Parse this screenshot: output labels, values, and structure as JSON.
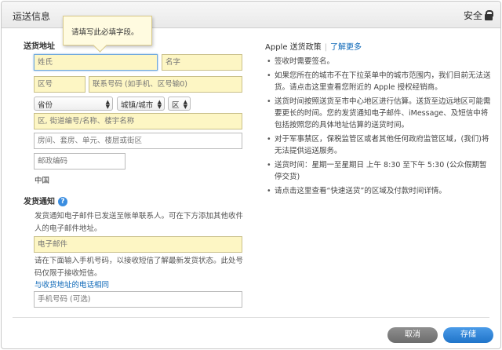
{
  "header": {
    "title": "运送信息",
    "secure_label": "安全"
  },
  "tooltip": {
    "text": "请填写此必填字段。"
  },
  "address": {
    "title": "送货地址",
    "surname_placeholder": "姓氏",
    "name_placeholder": "名字",
    "area_code_placeholder": "区号",
    "phone_placeholder": "联系号码 (如手机、区号输0)",
    "province_select": "省份",
    "city_select": "城镇/城市",
    "district_select": "区",
    "street_placeholder": "区, 街道编号/名称、楼宇名称",
    "unit_placeholder": "房间、套房、单元、楼层或街区",
    "postcode_placeholder": "邮政编码",
    "country": "中国"
  },
  "notification": {
    "title": "发货通知",
    "email_desc": "发货通知电子邮件已发送至帐单联系人。可在下方添加其他收件人的电子邮件地址。",
    "email_placeholder": "电子邮件",
    "sms_desc": "请在下面输入手机号码，以接收短信了解最新发货状态。此处号码仅限于接收短信。",
    "same_phone_link": "与收货地址的电话相同",
    "mobile_placeholder": "手机号码 (可选)"
  },
  "policy": {
    "title": "Apple 送货政策",
    "learn_more": "了解更多",
    "items": [
      "签收时需要签名。",
      "如果您所在的城市不在下拉菜单中的城市范围内，我们目前无法送货。请点击这里查看您附近的 Apple 授权经销商。",
      "送货时间按照送货至市中心地区进行估算。送货至边远地区可能需要更长的时间。您的发货通知电子邮件、iMessage、及短信中将包括按照您的具体地址估算的送货时间。",
      "对于军事禁区，保税监管区或者其他任何政府监管区域，(我们)将无法提供运送服务。",
      "送货时间：星期一至星期日 上午 8:30 至下午 5:30 (公众假期暂停交货)",
      "请点击这里查看“快速送货”的区域及付款时间详情。"
    ]
  },
  "buttons": {
    "cancel": "取消",
    "save": "存储"
  },
  "colors": {
    "accent": "#1f74c9",
    "required_field": "#fdf6c4",
    "link": "#0a66b7"
  }
}
